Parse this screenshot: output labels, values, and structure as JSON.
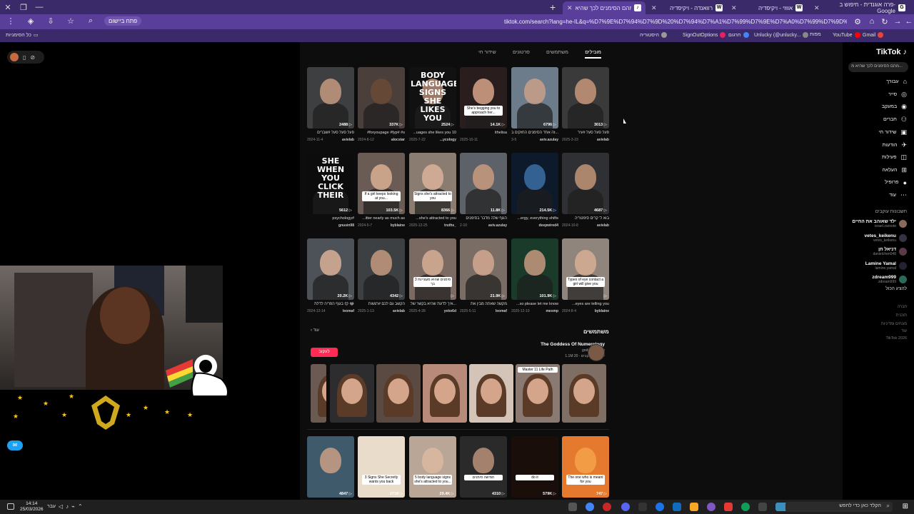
{
  "browser": {
    "tabs": [
      {
        "label": "פרה אוגנדית - חיפוש ב-Google",
        "favicon": "G",
        "active": false
      },
      {
        "label": "אווזי - ויקיפדיה",
        "favicon": "W",
        "active": false
      },
      {
        "label": "רוואנדה - ויקיפדיה",
        "favicon": "W",
        "active": false
      },
      {
        "label": "מצאו 'מהם הסימנים לכך שהיא...",
        "favicon": "♪",
        "active": true
      }
    ],
    "url": "tiktok.com/search?lang=he-IL&q=%D7%9E%D7%94%D7%9D%20%D7%94%D7%A1%D7%99%D7%9E%D7%A0%D7%99%D7%9D%20%D7%9C%D7%9B%D7%9A%20%D7%A9%D7%94%D7%99%D7%90...&t=1774440138884",
    "install_chip": "פתח ביישום",
    "bookmarks_left": "כל הסימניות",
    "bookmarks": [
      "Gmail",
      "YouTube",
      "Unlucky (@unlucky...",
      "חרגום",
      "SignOutOptions",
      "היסטוריה",
      "מפות"
    ]
  },
  "tiktok": {
    "logo": "TikTok",
    "search_value": "מהם הסימנים לכך שהיא מ...",
    "nav": [
      {
        "label": "עבורך",
        "icon": "home-icon"
      },
      {
        "label": "סייר",
        "icon": "explore-icon"
      },
      {
        "label": "במעקב",
        "icon": "following-icon"
      },
      {
        "label": "חברים",
        "icon": "friends-icon"
      },
      {
        "label": "שידור חי",
        "icon": "live-icon"
      },
      {
        "label": "הודעות",
        "icon": "messages-icon"
      },
      {
        "label": "פעילות",
        "icon": "activity-icon"
      },
      {
        "label": "העלאה",
        "icon": "upload-icon"
      },
      {
        "label": "פרופיל",
        "icon": "profile-icon"
      },
      {
        "label": "עוד",
        "icon": "more-icon"
      }
    ],
    "following_title": "חשבונות עוקבים",
    "following": [
      {
        "name": "ילד שאוהב את החיים",
        "handle": "israel.zaroote"
      },
      {
        "name": "vetes_keikenu",
        "handle": "vetes_keikenu"
      },
      {
        "name": "דניאל חן",
        "handle": "danielchen048"
      },
      {
        "name": "Lamine Yamal",
        "handle": "lamine.yamal"
      },
      {
        "name": "zdream999",
        "handle": "zdream999"
      }
    ],
    "show_all": "להציג הכול",
    "footer": [
      "חברה",
      "תוכנית",
      "מונחים ומדיניות",
      "עוד",
      "TikTok 2026"
    ],
    "search_tabs": [
      "מובילים",
      "משתמשים",
      "סרטונים",
      "שידור חי"
    ],
    "videos": [
      {
        "views": "3013",
        "desc": "פעל סעל סעל #עיר",
        "user": "avielab",
        "date": "2025-3-23",
        "bg": "#3a3a3a",
        "face": "#c9977a",
        "caption": "",
        "big": ""
      },
      {
        "views": "6796",
        "desc": "זה אחד הסימנים החזקים ב...",
        "user": "aviv.azulay",
        "date": "3-5",
        "bg": "#6d7c8a",
        "face": "#caa088",
        "caption": "",
        "big": ""
      },
      {
        "views": "14.1K",
        "desc": "ithelisa",
        "user": "",
        "date": "2025-10-11",
        "bg": "#2a1d1d",
        "face": "#d7a38a",
        "caption": "She's begging you to approach her...",
        "big": ""
      },
      {
        "views": "2524",
        "desc": "...uages she likes you 10",
        "user": "...ycology",
        "date": "2025-7-22",
        "bg": "#111111",
        "face": "#b68d77",
        "caption": "",
        "big": "BODY LANGUAGE SIGNS SHE LIKES YOU"
      },
      {
        "views": "337K",
        "desc": "#foryoupage #fyp# #s",
        "user": "alocstar",
        "date": "2024-8-12",
        "bg": "#4a3f3a",
        "face": "#6b4a36",
        "caption": "",
        "big": ""
      },
      {
        "views": "2488",
        "desc": "פעל סעל סעל #שברים",
        "user": "avielab",
        "date": "2024-11-4",
        "bg": "#3d3f40",
        "face": "#c49a80",
        "caption": "",
        "big": ""
      },
      {
        "views": "4687",
        "desc": "בוא ל' קרים סימטריה",
        "user": "avielab",
        "date": "2024-10-8",
        "bg": "#2f3033",
        "face": "#c29478",
        "caption": "",
        "big": ""
      },
      {
        "views": "214.5K",
        "desc": "...ergy, everything shifts",
        "user": "deepwired4",
        "date": "",
        "bg": "#0d1a2b",
        "face": "#3a6ea5",
        "caption": "",
        "big": ""
      },
      {
        "views": "11.8K",
        "desc": "הגוף שלה מדבר בסימנים",
        "user": "aviv.azulay",
        "date": "2-10",
        "bg": "#5d6268",
        "face": "#c99b80",
        "caption": "",
        "big": ""
      },
      {
        "views": "8366",
        "desc": "...she's attracted to you",
        "user": "truths_",
        "date": "2025-12-25",
        "bg": "#8a7c70",
        "face": "#d9b39a",
        "caption": "Signs she's attracted to you",
        "big": ""
      },
      {
        "views": "103.5K",
        "desc": "...itter nearly as much as",
        "user": "byblaine",
        "date": "2024-5-7",
        "bg": "#6a5c55",
        "face": "#d8ae93",
        "caption": "If a girl keeps looking at you...",
        "big": ""
      },
      {
        "views": "5612",
        "desc": "psychology#",
        "user": "gnusin98",
        "date": "",
        "bg": "#0c0c0c",
        "face": "#0c0c0c",
        "caption": "",
        "big": "SHE WHEN YOU CLICK THEIR"
      },
      {
        "views": "",
        "desc": "...eyes are telling you",
        "user": "byblaine",
        "date": "2024-8-4",
        "bg": "#8f857d",
        "face": "#d8ae94",
        "caption": "Types of eye contact a girl will give you",
        "big": ""
      },
      {
        "views": "101.9K",
        "desc": "...so please let me know",
        "user": "mexmp",
        "date": "2025-12-10",
        "bg": "#1a3a2a",
        "face": "#c89a80",
        "caption": "",
        "big": ""
      },
      {
        "views": "21.9K",
        "desc": "מקשה שאתה מבין את",
        "user": "leomaf",
        "date": "2025-5-11",
        "bg": "#7a6d66",
        "face": "#d2a890",
        "caption": "",
        "big": ""
      },
      {
        "views": "",
        "desc": "איך לדעת שהיא בקשר של...",
        "user": "yeko6d",
        "date": "2025-4-28",
        "bg": "#7a6a62",
        "face": "#d7ae95",
        "caption": "3 סימנים שהיא מעוניינת בך",
        "big": ""
      },
      {
        "views": "4342",
        "desc": "הקשב גם לכם #רגשות",
        "user": "avielab",
        "date": "2025-1-13",
        "bg": "#3c4043",
        "face": "#c49a80",
        "caption": "",
        "big": ""
      },
      {
        "views": "20.2K",
        "desc": "בגוף הפריה לדלת 😊 😂",
        "user": "leomaf",
        "date": "2024-12-14",
        "bg": "#4d5258",
        "face": "#dbb097",
        "caption": "",
        "big": ""
      }
    ],
    "users_title": "משתמשים",
    "more_label": "עוד",
    "user_card": {
      "name": "The Goddess Of Numerology",
      "handle": "goddessgiving",
      "stats": "1.1M עוקבים · 20M לייקים",
      "follow": "לעקוב"
    },
    "strip_labels": [
      "",
      "Master 11 Life Path",
      "",
      "",
      "",
      "",
      ""
    ],
    "bottom_videos": [
      {
        "views": "4847",
        "bg": "#3f5a6a",
        "face": "#caa085",
        "caption": ""
      },
      {
        "views": "2718",
        "bg": "#e9dccb",
        "face": "#e9dccb",
        "caption": "3 Signs She Secretly wants you back"
      },
      {
        "views": "29.4K",
        "bg": "#b9a697",
        "face": "#dcb8a0",
        "caption": "5 body language signs she's attracted to you..."
      },
      {
        "views": "4310",
        "bg": "#2a2a2a",
        "face": "#b99078",
        "caption": "חמישה סימנים"
      },
      {
        "views": "579K",
        "bg": "#1a0e0a",
        "face": "#1a0e0a",
        "caption": "do it"
      },
      {
        "views": "747",
        "bg": "#e57a2e",
        "face": "#f5a34a",
        "caption": "The one who is meant for you"
      }
    ]
  },
  "taskbar": {
    "search_placeholder": "הקלד כאן כדי לחפש",
    "time": "14:14",
    "date": "25/03/2026",
    "lang": "עבר"
  }
}
